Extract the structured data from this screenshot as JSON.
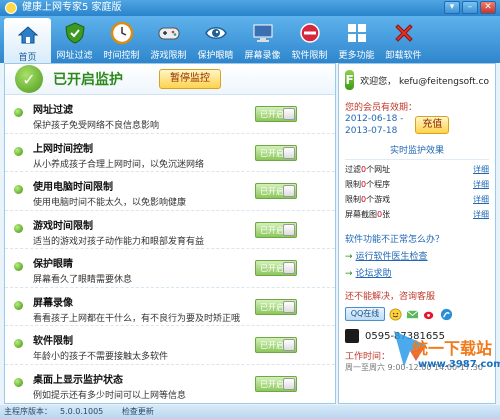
{
  "window": {
    "title": "健康上网专家5 家庭版",
    "buttons": [
      "▾",
      "–",
      "✕"
    ]
  },
  "toolbar": [
    {
      "label": "首页",
      "icon": "home-icon",
      "active": true
    },
    {
      "label": "网址过滤",
      "icon": "shield-icon",
      "active": false
    },
    {
      "label": "时间控制",
      "icon": "clock-icon",
      "active": false
    },
    {
      "label": "游戏限制",
      "icon": "gamepad-icon",
      "active": false
    },
    {
      "label": "保护眼睛",
      "icon": "eye-icon",
      "active": false
    },
    {
      "label": "屏幕录像",
      "icon": "monitor-icon",
      "active": false
    },
    {
      "label": "软件限制",
      "icon": "software-icon",
      "active": false
    },
    {
      "label": "更多功能",
      "icon": "more-icon",
      "active": false
    },
    {
      "label": "卸载软件",
      "icon": "uninstall-icon",
      "active": false
    }
  ],
  "status": {
    "text": "已开启监护",
    "pause_button": "暂停监控"
  },
  "features": [
    {
      "title": "网址过滤",
      "desc": "保护孩子免受网络不良信息影响",
      "toggle": "已开启"
    },
    {
      "title": "上网时间控制",
      "desc": "从小养成孩子合理上网时间，以免沉迷网络",
      "toggle": "已开启"
    },
    {
      "title": "使用电脑时间限制",
      "desc": "使用电脑时间不能太久，以免影响健康",
      "toggle": "已开启"
    },
    {
      "title": "游戏时间限制",
      "desc": "适当的游戏对孩子动作能力和眼部发育有益",
      "toggle": "已开启"
    },
    {
      "title": "保护眼睛",
      "desc": "屏幕看久了眼睛需要休息",
      "toggle": "已开启"
    },
    {
      "title": "屏幕录像",
      "desc": "看看孩子上网都在干什么，有不良行为要及时矫正哦",
      "toggle": "已开启"
    },
    {
      "title": "软件限制",
      "desc": "年龄小的孩子不需要接触太多软件",
      "toggle": "已开启"
    },
    {
      "title": "桌面上显示监护状态",
      "desc": "例如提示还有多少时间可以上网等信息",
      "toggle": "已开启"
    }
  ],
  "sidebar": {
    "welcome": "欢迎您，  kefu@feitengsoft.co",
    "member_title": "您的会员有效期：",
    "date_start": "2012-06-18 -",
    "date_end": "2013-07-18",
    "recharge": "充值",
    "effect_title": "实时监护效果",
    "effects": [
      {
        "pre": "过滤",
        "num": "0",
        "post": "个网址",
        "detail": "详细"
      },
      {
        "pre": "限制",
        "num": "0",
        "post": "个程序",
        "detail": "详细"
      },
      {
        "pre": "限制",
        "num": "0",
        "post": "个游戏",
        "detail": "详细"
      },
      {
        "pre": "屏幕截图",
        "num": "0",
        "post": "张",
        "detail": "详细"
      }
    ],
    "qa_title": "软件功能不正常怎么办？",
    "links": [
      "运行软件医生检查",
      "论坛求助"
    ],
    "contact_title": "还不能解决，咨询客服",
    "qq": "QQ在线",
    "phone": "0595-87381655",
    "worktime_title": "工作时间：",
    "worktime_detail": "周一至周六 9:00-12:00 14:00-17:30"
  },
  "watermark": {
    "big": "统一下载站",
    "url": "www.3987.com"
  },
  "footer": {
    "version_label": "主程序版本：",
    "version": "5.0.0.1005",
    "update": "检查更新"
  }
}
